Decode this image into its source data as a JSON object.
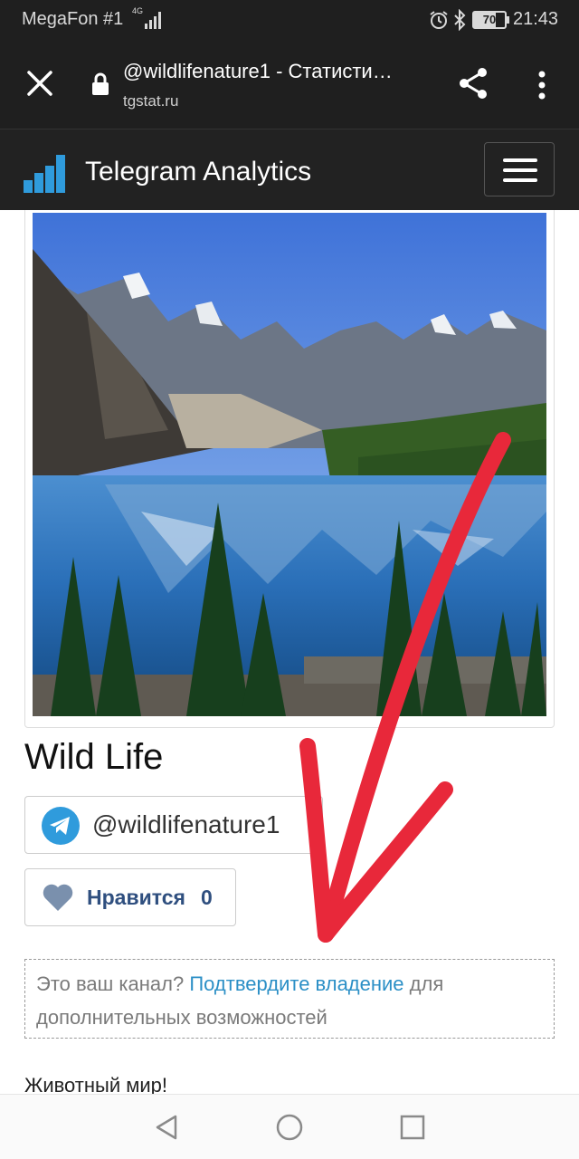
{
  "status_bar": {
    "carrier": "MegaFon #1",
    "network": "4G",
    "battery_level": "70",
    "time": "21:43"
  },
  "browser": {
    "title": "@wildlifenature1 - Статисти…",
    "domain": "tgstat.ru"
  },
  "site_header": {
    "brand": "Telegram Analytics"
  },
  "channel": {
    "title": "Wild Life",
    "handle": "@wildlifenature1",
    "like_label": "Нравится",
    "like_count": "0",
    "description": "Животный мир!"
  },
  "claim": {
    "prefix": "Это ваш канал?",
    "link": "Подтвердите владение",
    "suffix": "для дополнительных возможностей"
  },
  "colors": {
    "header_bg": "#222222",
    "status_bg": "#1f1f1f",
    "link": "#2b8fc6",
    "like_text": "#2f4f7f",
    "annotation_arrow": "#e8283a",
    "logo_blue": "#2f9bdc"
  },
  "icons": {
    "close": "close-icon",
    "lock": "lock-icon",
    "share": "share-icon",
    "more": "more-vertical-icon",
    "menu": "hamburger-icon",
    "telegram": "telegram-icon",
    "like": "heart-icon",
    "nav_back": "back-triangle-icon",
    "nav_home": "home-circle-icon",
    "nav_recents": "recents-square-icon"
  }
}
